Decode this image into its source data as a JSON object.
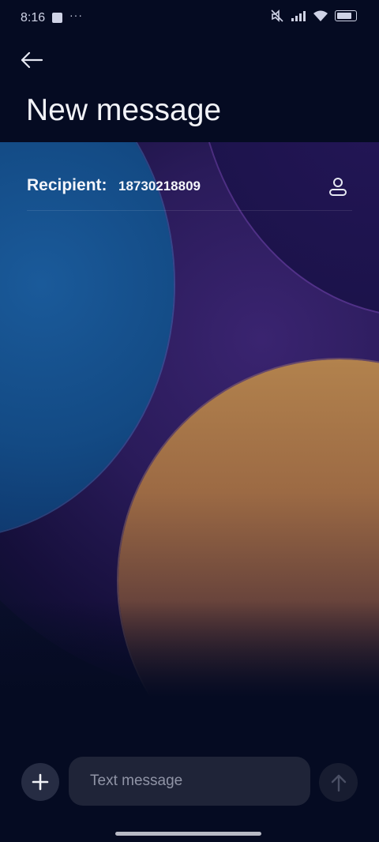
{
  "status_bar": {
    "time": "8:16",
    "dots": "···",
    "icons": [
      "mute-icon",
      "signal-icon",
      "wifi-icon",
      "battery-icon"
    ]
  },
  "header": {
    "back_icon": "arrow-left-icon",
    "title": "New message"
  },
  "recipient": {
    "label": "Recipient:",
    "value": "18730218809",
    "contact_icon": "person-icon"
  },
  "composer": {
    "add_icon": "plus-icon",
    "placeholder": "Text message",
    "send_icon": "arrow-up-icon"
  },
  "colors": {
    "background": "#050b22",
    "input_bg": "#1f2438",
    "text": "#f2f3f8"
  }
}
